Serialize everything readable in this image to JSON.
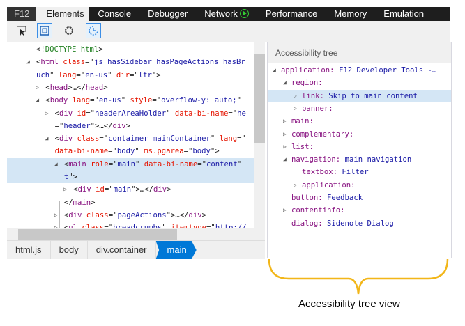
{
  "tabs": [
    {
      "label": "F12"
    },
    {
      "label": "Elements",
      "active": true
    },
    {
      "label": "Console"
    },
    {
      "label": "Debugger"
    },
    {
      "label": "Network"
    },
    {
      "label": "Performance"
    },
    {
      "label": "Memory"
    },
    {
      "label": "Emulation"
    }
  ],
  "toolbar": {
    "buttons": [
      "select-element-icon",
      "highlight-boxes-icon",
      "circle-icon",
      "refresh-dom-icon"
    ]
  },
  "dom_lines": [
    {
      "i": 0,
      "arrow": "",
      "tok": [
        [
          "p",
          "<!"
        ],
        [
          "g",
          "DOCTYPE html"
        ],
        [
          "p",
          ">"
        ]
      ]
    },
    {
      "i": 0,
      "arrow": "down",
      "tok": [
        [
          "p",
          "<"
        ],
        [
          "t",
          "html "
        ],
        [
          "a",
          "class"
        ],
        [
          "p",
          "=\""
        ],
        [
          "v",
          "js hasSidebar hasPageActions hasBr"
        ]
      ]
    },
    {
      "i": 0,
      "arrow": "",
      "tok": [
        [
          "v",
          "uch"
        ],
        [
          "p",
          "\" "
        ],
        [
          "a",
          "lang"
        ],
        [
          "p",
          "=\""
        ],
        [
          "v",
          "en-us"
        ],
        [
          "p",
          "\" "
        ],
        [
          "a",
          "dir"
        ],
        [
          "p",
          "=\""
        ],
        [
          "v",
          "ltr"
        ],
        [
          "p",
          "\">"
        ]
      ]
    },
    {
      "i": 1,
      "arrow": "right",
      "tok": [
        [
          "p",
          "<"
        ],
        [
          "t",
          "head"
        ],
        [
          "p",
          ">…</"
        ],
        [
          "t",
          "head"
        ],
        [
          "p",
          ">"
        ]
      ]
    },
    {
      "i": 1,
      "arrow": "down",
      "tok": [
        [
          "p",
          "<"
        ],
        [
          "t",
          "body "
        ],
        [
          "a",
          "lang"
        ],
        [
          "p",
          "=\""
        ],
        [
          "v",
          "en-us"
        ],
        [
          "p",
          "\" "
        ],
        [
          "a",
          "style"
        ],
        [
          "p",
          "=\""
        ],
        [
          "v",
          "overflow-y: auto;"
        ],
        [
          "p",
          "\""
        ]
      ]
    },
    {
      "i": 2,
      "arrow": "right",
      "tok": [
        [
          "p",
          "<"
        ],
        [
          "t",
          "div "
        ],
        [
          "a",
          "id"
        ],
        [
          "p",
          "=\""
        ],
        [
          "v",
          "headerAreaHolder"
        ],
        [
          "p",
          "\" "
        ],
        [
          "a",
          "data-bi-name"
        ],
        [
          "p",
          "=\""
        ],
        [
          "v",
          "he"
        ]
      ]
    },
    {
      "i": 2,
      "arrow": "",
      "tok": [
        [
          "p",
          "=\""
        ],
        [
          "v",
          "header"
        ],
        [
          "p",
          "\">…</"
        ],
        [
          "t",
          "div"
        ],
        [
          "p",
          ">"
        ]
      ]
    },
    {
      "i": 2,
      "arrow": "down",
      "tok": [
        [
          "p",
          "<"
        ],
        [
          "t",
          "div "
        ],
        [
          "a",
          "class"
        ],
        [
          "p",
          "=\""
        ],
        [
          "v",
          "container mainContainer"
        ],
        [
          "p",
          "\" "
        ],
        [
          "a",
          "lang"
        ],
        [
          "p",
          "=\""
        ]
      ]
    },
    {
      "i": 2,
      "arrow": "",
      "tok": [
        [
          "a",
          "data-bi-name"
        ],
        [
          "p",
          "=\""
        ],
        [
          "v",
          "body"
        ],
        [
          "p",
          "\" "
        ],
        [
          "a",
          "ms.pgarea"
        ],
        [
          "p",
          "=\""
        ],
        [
          "v",
          "body"
        ],
        [
          "p",
          "\">"
        ]
      ]
    },
    {
      "i": 3,
      "arrow": "down",
      "sel": true,
      "tok": [
        [
          "p",
          "<"
        ],
        [
          "t",
          "main "
        ],
        [
          "a",
          "role"
        ],
        [
          "p",
          "=\""
        ],
        [
          "v",
          "main"
        ],
        [
          "p",
          "\" "
        ],
        [
          "a",
          "data-bi-name"
        ],
        [
          "p",
          "=\""
        ],
        [
          "v",
          "content"
        ],
        [
          "p",
          "\""
        ]
      ]
    },
    {
      "i": 3,
      "arrow": "",
      "sel": true,
      "tok": [
        [
          "v",
          "t"
        ],
        [
          "p",
          "\">"
        ]
      ]
    },
    {
      "i": 4,
      "arrow": "right",
      "tok": [
        [
          "p",
          "<"
        ],
        [
          "t",
          "div "
        ],
        [
          "a",
          "id"
        ],
        [
          "p",
          "=\""
        ],
        [
          "v",
          "main"
        ],
        [
          "p",
          "\">…</"
        ],
        [
          "t",
          "div"
        ],
        [
          "p",
          ">"
        ]
      ]
    },
    {
      "i": 3,
      "arrow": "",
      "tok": [
        [
          "p",
          "</"
        ],
        [
          "t",
          "main"
        ],
        [
          "p",
          ">"
        ]
      ]
    },
    {
      "i": 3,
      "arrow": "right",
      "tok": [
        [
          "p",
          "<"
        ],
        [
          "t",
          "div "
        ],
        [
          "a",
          "class"
        ],
        [
          "p",
          "=\""
        ],
        [
          "v",
          "pageActions"
        ],
        [
          "p",
          "\">…</"
        ],
        [
          "t",
          "div"
        ],
        [
          "p",
          ">"
        ]
      ]
    },
    {
      "i": 3,
      "arrow": "right",
      "tok": [
        [
          "p",
          "<"
        ],
        [
          "t",
          "ul "
        ],
        [
          "a",
          "class"
        ],
        [
          "p",
          "=\""
        ],
        [
          "v",
          "breadcrumbs"
        ],
        [
          "p",
          "\" "
        ],
        [
          "a",
          "itemtype"
        ],
        [
          "p",
          "=\""
        ],
        [
          "v",
          "http://"
        ]
      ]
    }
  ],
  "breadcrumbs": [
    {
      "label": "html.js"
    },
    {
      "label": "body"
    },
    {
      "label": "div.container"
    },
    {
      "label": "main",
      "active": true
    }
  ],
  "accessibility": {
    "title": "Accessibility tree",
    "rows": [
      {
        "i": 0,
        "arrow": "down",
        "role": "application:",
        "name": "F12 Developer Tools -…"
      },
      {
        "i": 1,
        "arrow": "down",
        "role": "region:",
        "name": ""
      },
      {
        "i": 2,
        "arrow": "right",
        "role": "link:",
        "name": "Skip to main content",
        "sel": true
      },
      {
        "i": 2,
        "arrow": "right",
        "role": "banner:",
        "name": ""
      },
      {
        "i": 1,
        "arrow": "right",
        "role": "main:",
        "name": ""
      },
      {
        "i": 1,
        "arrow": "right",
        "role": "complementary:",
        "name": ""
      },
      {
        "i": 1,
        "arrow": "right",
        "role": "list:",
        "name": ""
      },
      {
        "i": 1,
        "arrow": "down",
        "role": "navigation:",
        "name": "main navigation"
      },
      {
        "i": 2,
        "arrow": "",
        "role": "textbox:",
        "name": "Filter"
      },
      {
        "i": 2,
        "arrow": "right",
        "role": "application:",
        "name": ""
      },
      {
        "i": 1,
        "arrow": "",
        "role": "button:",
        "name": "Feedback"
      },
      {
        "i": 1,
        "arrow": "right",
        "role": "contentinfo:",
        "name": ""
      },
      {
        "i": 1,
        "arrow": "",
        "role": "dialog:",
        "name": "Sidenote Dialog"
      }
    ]
  },
  "annotation": {
    "caption": "Accessibility tree view",
    "color": "#f2b619"
  }
}
